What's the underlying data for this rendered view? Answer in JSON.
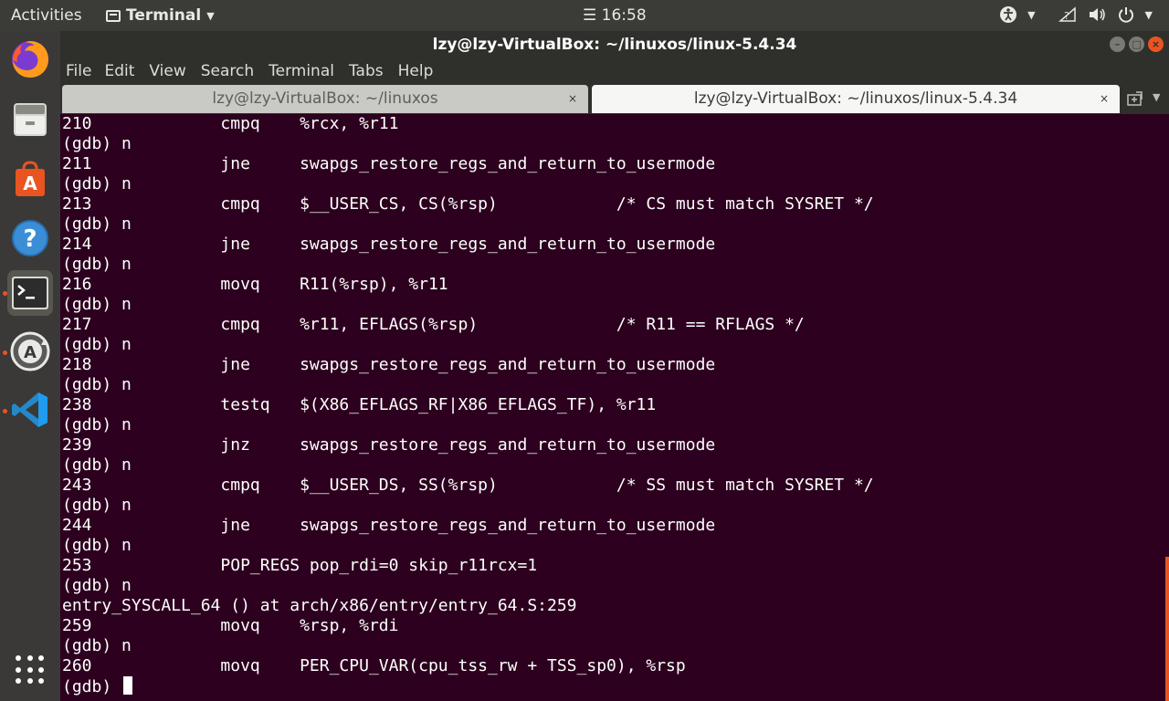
{
  "topbar": {
    "activities": "Activities",
    "app_name": "Terminal",
    "clock": "16:58"
  },
  "dock": {
    "items": [
      "Firefox",
      "Files",
      "Ubuntu Software",
      "Help",
      "Terminal",
      "Software Updater",
      "Visual Studio Code"
    ],
    "accent_color": "#e95420"
  },
  "window": {
    "title": "lzy@lzy-VirtualBox: ~/linuxos/linux-5.4.34",
    "menu": [
      "File",
      "Edit",
      "View",
      "Search",
      "Terminal",
      "Tabs",
      "Help"
    ],
    "tabs": [
      {
        "label": "lzy@lzy-VirtualBox: ~/linuxos",
        "close": "×"
      },
      {
        "label": "lzy@lzy-VirtualBox: ~/linuxos/linux-5.4.34",
        "close": "×"
      }
    ],
    "background_color": "#2c001e"
  },
  "terminal": {
    "lines": [
      "210\t\tcmpq\t%rcx, %r11",
      "(gdb) n",
      "211\t\tjne\tswapgs_restore_regs_and_return_to_usermode",
      "(gdb) n",
      "213\t\tcmpq\t$__USER_CS, CS(%rsp)\t\t/* CS must match SYSRET */",
      "(gdb) n",
      "214\t\tjne\tswapgs_restore_regs_and_return_to_usermode",
      "(gdb) n",
      "216\t\tmovq\tR11(%rsp), %r11",
      "(gdb) n",
      "217\t\tcmpq\t%r11, EFLAGS(%rsp)\t\t/* R11 == RFLAGS */",
      "(gdb) n",
      "218\t\tjne\tswapgs_restore_regs_and_return_to_usermode",
      "(gdb) n",
      "238\t\ttestq\t$(X86_EFLAGS_RF|X86_EFLAGS_TF), %r11",
      "(gdb) n",
      "239\t\tjnz\tswapgs_restore_regs_and_return_to_usermode",
      "(gdb) n",
      "243\t\tcmpq\t$__USER_DS, SS(%rsp)\t\t/* SS must match SYSRET */",
      "(gdb) n",
      "244\t\tjne\tswapgs_restore_regs_and_return_to_usermode",
      "(gdb) n",
      "253\t\tPOP_REGS pop_rdi=0 skip_r11rcx=1",
      "(gdb) n",
      "entry_SYSCALL_64 () at arch/x86/entry/entry_64.S:259",
      "259\t\tmovq\t%rsp, %rdi",
      "(gdb) n",
      "260\t\tmovq\tPER_CPU_VAR(cpu_tss_rw + TSS_sp0), %rsp"
    ],
    "prompt": "(gdb) "
  }
}
